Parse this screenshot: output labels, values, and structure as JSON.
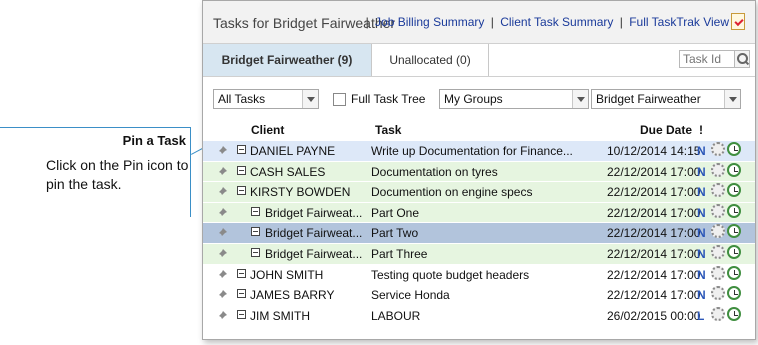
{
  "callout": {
    "title": "Pin a Task",
    "body": "Click on the Pin icon to pin the task."
  },
  "header": {
    "title": "Tasks for Bridget Fairweather",
    "links": [
      "Job Billing Summary",
      "Client Task Summary",
      "Full TaskTrak View"
    ],
    "separator": "|"
  },
  "tabs": [
    {
      "label": "Bridget Fairweather (9)",
      "active": true
    },
    {
      "label": "Unallocated (0)",
      "active": false
    }
  ],
  "search": {
    "placeholder": "Task Id"
  },
  "filters": {
    "task_scope": "All Tasks",
    "full_task_tree_label": "Full Task Tree",
    "groups": "My Groups",
    "person": "Bridget Fairweather"
  },
  "columns": {
    "client": "Client",
    "task": "Task",
    "due": "Due Date",
    "flag": "!"
  },
  "rows": [
    {
      "client": "DANIEL PAYNE",
      "task": "Write up Documentation for Finance...",
      "due": "10/12/2014 14:15",
      "pri": "N",
      "style": "blue"
    },
    {
      "client": "CASH SALES",
      "task": "Documentation on tyres",
      "due": "22/12/2014 17:00",
      "pri": "N",
      "style": "green"
    },
    {
      "client": "KIRSTY BOWDEN",
      "task": "Documention on engine specs",
      "due": "22/12/2014 17:00",
      "pri": "N",
      "style": "green"
    },
    {
      "client": "Bridget Fairweat...",
      "task": "Part One",
      "due": "22/12/2014 17:00",
      "pri": "N",
      "style": "green"
    },
    {
      "client": "Bridget Fairweat...",
      "task": "Part Two",
      "due": "22/12/2014 17:00",
      "pri": "N",
      "style": "sel"
    },
    {
      "client": "Bridget Fairweat...",
      "task": "Part Three",
      "due": "22/12/2014 17:00",
      "pri": "N",
      "style": "green"
    },
    {
      "client": "JOHN SMITH",
      "task": "Testing quote budget headers",
      "due": "22/12/2014 17:00",
      "pri": "N",
      "style": "white"
    },
    {
      "client": "JAMES BARRY",
      "task": "Service Honda",
      "due": "22/12/2014 17:00",
      "pri": "N",
      "style": "white"
    },
    {
      "client": "JIM SMITH",
      "task": "LABOUR",
      "due": "26/02/2015 00:00",
      "pri": "L",
      "style": "white"
    }
  ],
  "colors": {
    "accent": "#3b8fc7",
    "active_tab": "#d7e6f1",
    "green_row": "#e6f5e0",
    "selected_row": "#b2c4dc",
    "link": "#1a3a9a"
  }
}
